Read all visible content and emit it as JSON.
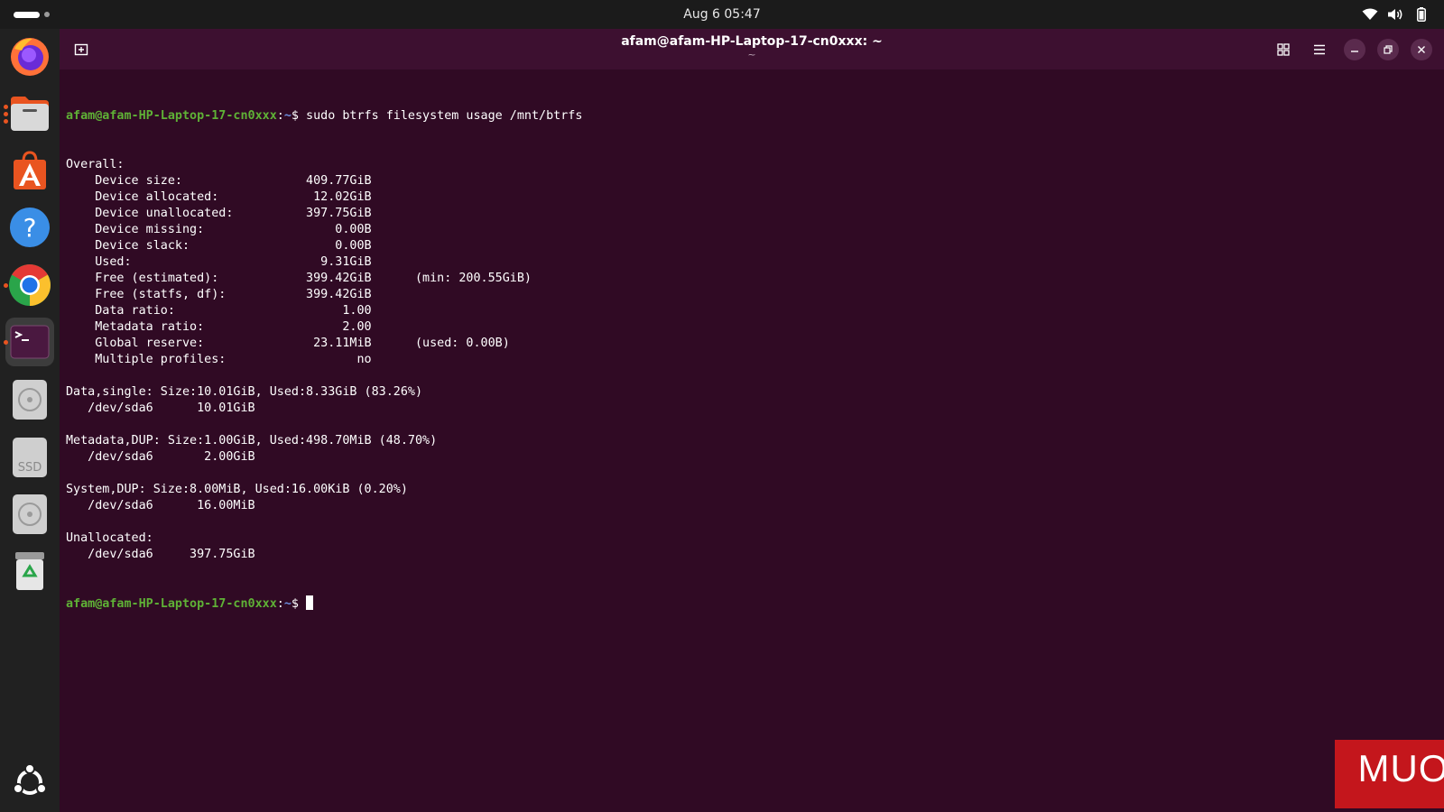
{
  "topbar": {
    "datetime": "Aug 6  05:47",
    "icons": [
      "wifi-icon",
      "volume-icon",
      "battery-icon"
    ]
  },
  "dock": {
    "items": [
      {
        "name": "firefox",
        "icon": "firefox-icon"
      },
      {
        "name": "files",
        "icon": "files-icon"
      },
      {
        "name": "app-center",
        "icon": "app-center-icon"
      },
      {
        "name": "help",
        "icon": "help-icon"
      },
      {
        "name": "chrome",
        "icon": "chrome-icon"
      },
      {
        "name": "terminal",
        "icon": "terminal-icon"
      },
      {
        "name": "disk-1",
        "icon": "disk-icon"
      },
      {
        "name": "ssd",
        "icon": "ssd-icon",
        "label": "SSD"
      },
      {
        "name": "disk-2",
        "icon": "disk-icon"
      },
      {
        "name": "trash",
        "icon": "trash-icon"
      },
      {
        "name": "show-apps",
        "icon": "ubuntu-icon"
      }
    ]
  },
  "window": {
    "title": "afam@afam-HP-Laptop-17-cn0xxx: ~",
    "subtitle": "~"
  },
  "terminal": {
    "prompt_user": "afam@afam-HP-Laptop-17-cn0xxx",
    "prompt_path": "~",
    "prompt_symbol": "$",
    "command": "sudo btrfs filesystem usage /mnt/btrfs",
    "output": [
      "Overall:",
      "    Device size:                 409.77GiB",
      "    Device allocated:             12.02GiB",
      "    Device unallocated:          397.75GiB",
      "    Device missing:                  0.00B",
      "    Device slack:                    0.00B",
      "    Used:                          9.31GiB",
      "    Free (estimated):            399.42GiB      (min: 200.55GiB)",
      "    Free (statfs, df):           399.42GiB",
      "    Data ratio:                       1.00",
      "    Metadata ratio:                   2.00",
      "    Global reserve:               23.11MiB      (used: 0.00B)",
      "    Multiple profiles:                  no",
      "",
      "Data,single: Size:10.01GiB, Used:8.33GiB (83.26%)",
      "   /dev/sda6      10.01GiB",
      "",
      "Metadata,DUP: Size:1.00GiB, Used:498.70MiB (48.70%)",
      "   /dev/sda6       2.00GiB",
      "",
      "System,DUP: Size:8.00MiB, Used:16.00KiB (0.20%)",
      "   /dev/sda6      16.00MiB",
      "",
      "Unallocated:",
      "   /dev/sda6     397.75GiB"
    ]
  },
  "watermark": {
    "text": "MUO"
  }
}
